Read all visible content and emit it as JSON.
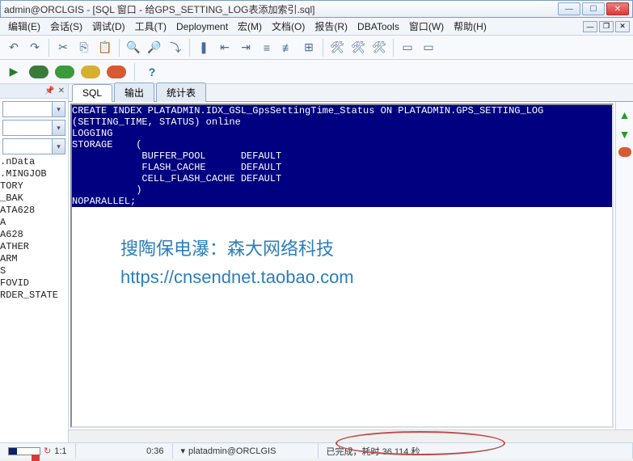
{
  "title": "admin@ORCLGIS - [SQL 窗口 - 给GPS_SETTING_LOG表添加索引.sql]",
  "menu": [
    "编辑(E)",
    "会话(S)",
    "调试(D)",
    "工具(T)",
    "Deployment",
    "宏(M)",
    "文档(O)",
    "报告(R)",
    "DBATools",
    "窗口(W)",
    "帮助(H)"
  ],
  "tabs": [
    {
      "label": "SQL",
      "active": true
    },
    {
      "label": "输出",
      "active": false
    },
    {
      "label": "统计表",
      "active": false
    }
  ],
  "sql_lines": [
    "CREATE INDEX PLATADMIN.IDX_GSL_GpsSettingTime_Status ON PLATADMIN.GPS_SETTING_LOG",
    "(SETTING_TIME, STATUS) online",
    "LOGGING",
    "STORAGE    (",
    "            BUFFER_POOL      DEFAULT",
    "            FLASH_CACHE      DEFAULT",
    "            CELL_FLASH_CACHE DEFAULT",
    "           )",
    "NOPARALLEL;"
  ],
  "objects": [
    "",
    "",
    "",
    "",
    "",
    "",
    "",
    ".nData",
    ".MINGJOB",
    "",
    "TORY",
    "_BAK",
    "",
    "",
    "ATA628",
    "A",
    "A628",
    "",
    "ATHER",
    "ARM",
    "S",
    "FOVID",
    "RDER_STATE"
  ],
  "watermark": {
    "line1": "搜陶保电瀑：森大网络科技",
    "line2": "https://cnsendnet.taobao.com"
  },
  "status": {
    "ratio": "1:1",
    "pos": "0:36",
    "user": "platadmin@ORCLGIS",
    "msg": "已完成，耗时 36.114 秒"
  }
}
